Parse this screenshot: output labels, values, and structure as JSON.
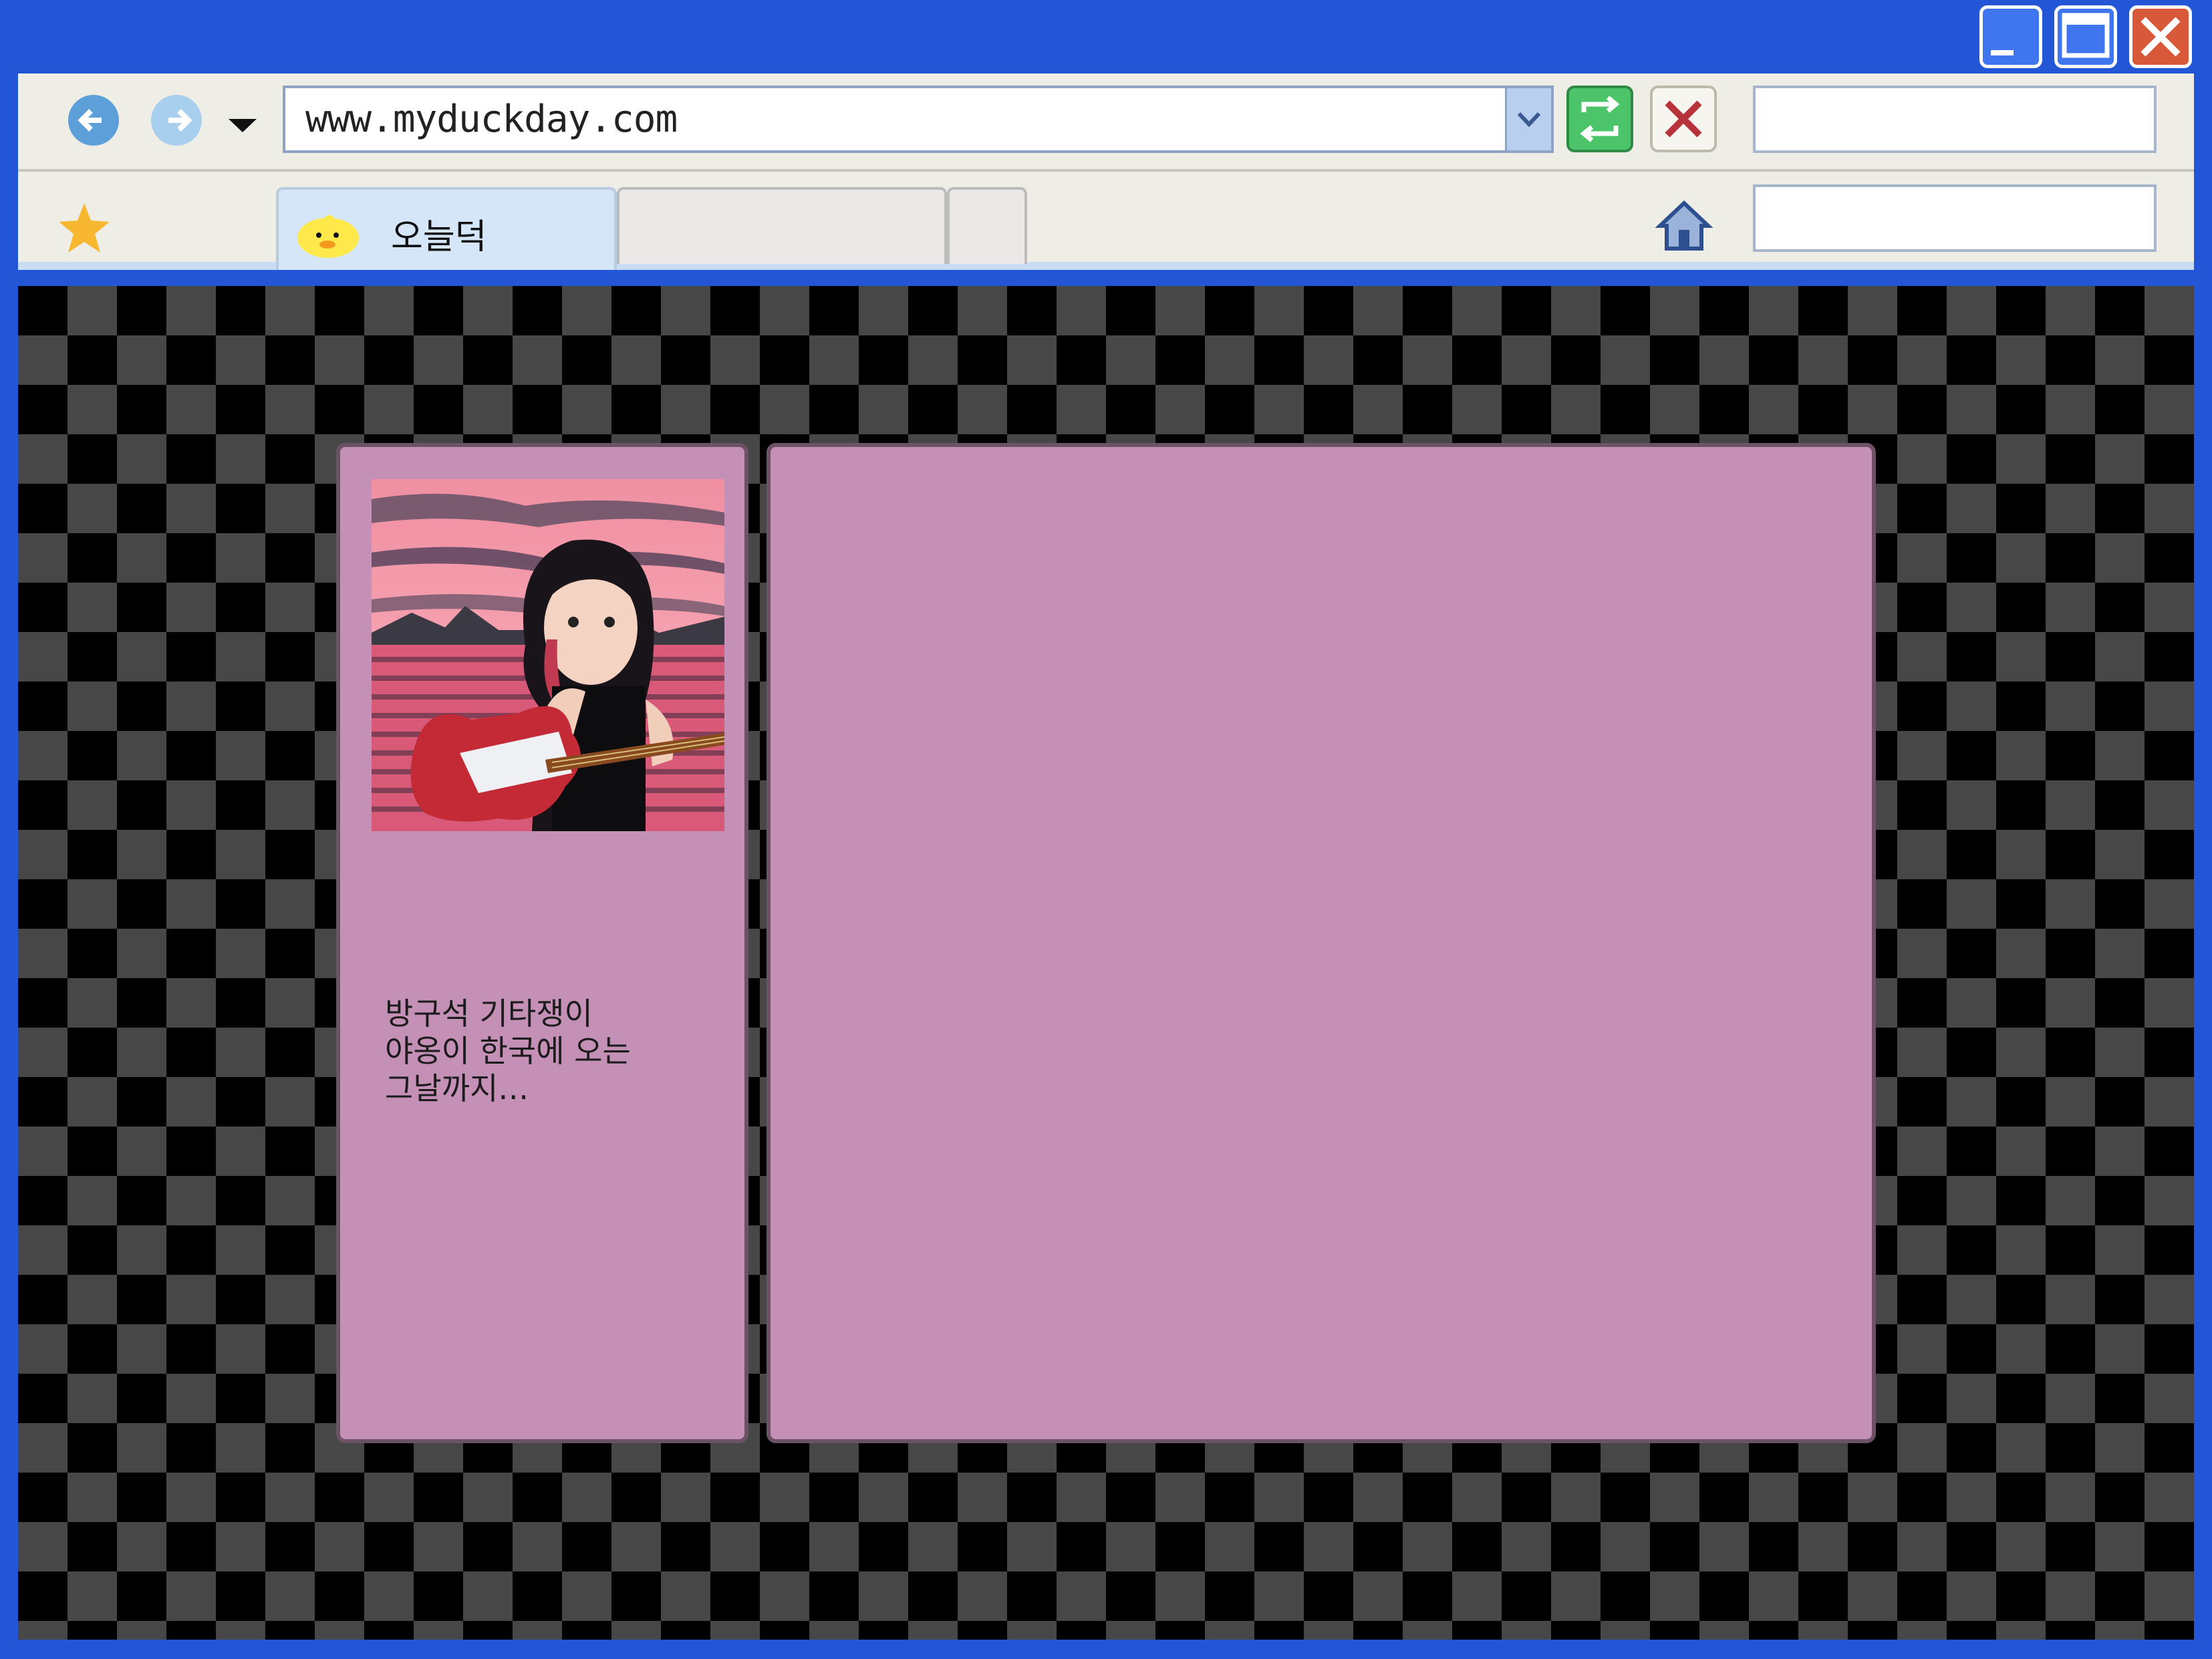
{
  "browser": {
    "url": "www.myduckday.com",
    "active_tab_label": "오늘덕",
    "window_buttons": [
      "minimize-icon",
      "maximize-icon",
      "close-icon"
    ],
    "nav_icons": [
      "back-arrow-icon",
      "forward-arrow-icon",
      "history-dropdown-icon",
      "refresh-icon",
      "stop-icon",
      "star-icon",
      "home-icon",
      "duck-icon"
    ]
  },
  "profile": {
    "description": "방구석 기타쟁이\n야옹이 한국에 오는\n그날까지…"
  },
  "colors": {
    "titlebar": "#2356d6",
    "panel": "#c490b6",
    "panel_border": "#6d5266",
    "checker_dark": "#000000",
    "checker_light": "#474747",
    "toolbar": "#efeee6",
    "active_tab": "#d4e6f8"
  }
}
